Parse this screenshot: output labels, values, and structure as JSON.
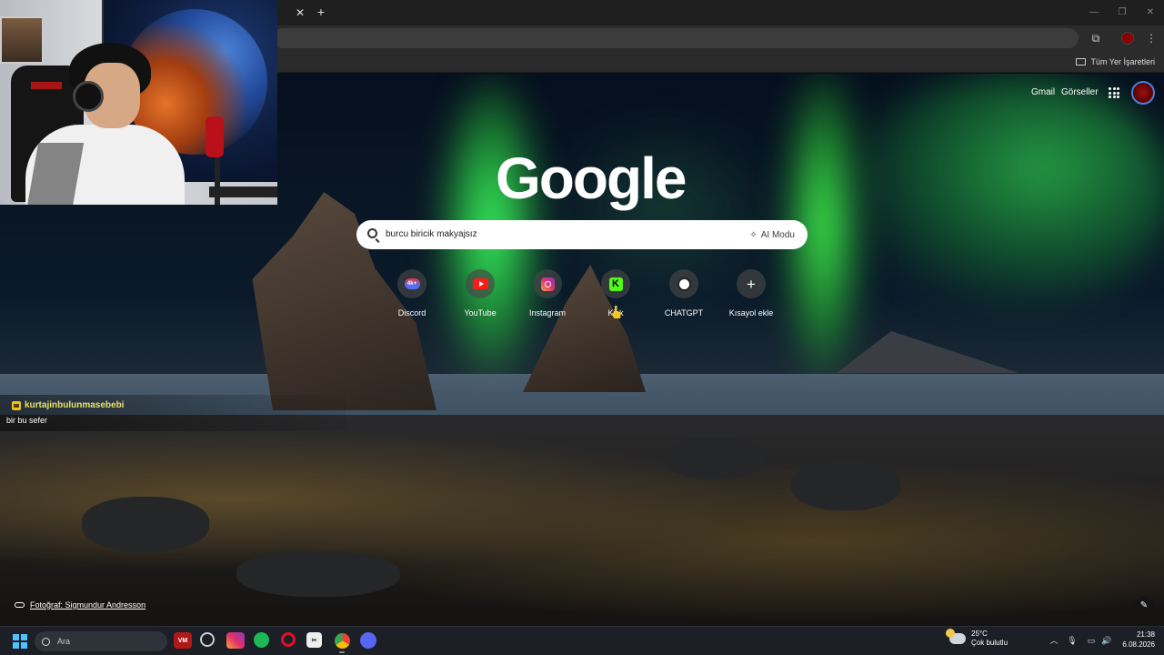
{
  "browser": {
    "bookmarks_all_label": "Tüm Yer İşaretleri"
  },
  "google": {
    "gmail_label": "Gmail",
    "images_label": "Görseller",
    "logo_text": "Google",
    "search_value": "burcu biricik makyajsız",
    "ai_mode_label": "AI Modu"
  },
  "shortcuts": [
    {
      "label": "Discord",
      "icon": "discord-icon",
      "badge": "4k+"
    },
    {
      "label": "YouTube",
      "icon": "youtube-icon"
    },
    {
      "label": "Instagram",
      "icon": "instagram-icon"
    },
    {
      "label": "Kick",
      "icon": "kick-icon",
      "glyph": "K"
    },
    {
      "label": "CHATGPT",
      "icon": "chatgpt-icon"
    },
    {
      "label": "Kısayol ekle",
      "icon": "plus-icon",
      "glyph": "+"
    }
  ],
  "photo_credit": "Fotoğraf: Sigmundur Andresson",
  "chat": {
    "username": "kurtajinbulunmasebebi",
    "message": "bir bu sefer"
  },
  "taskbar": {
    "search_label": "Ara",
    "weather_temp": "25°C",
    "weather_desc": "Çok bulutlu",
    "time": "21:38",
    "date": "6.08.2026"
  },
  "colors": {
    "accent": "#4cc2ff",
    "chat_username": "#e9e16a",
    "kick": "#53fc18",
    "youtube": "#ff1a1a"
  }
}
